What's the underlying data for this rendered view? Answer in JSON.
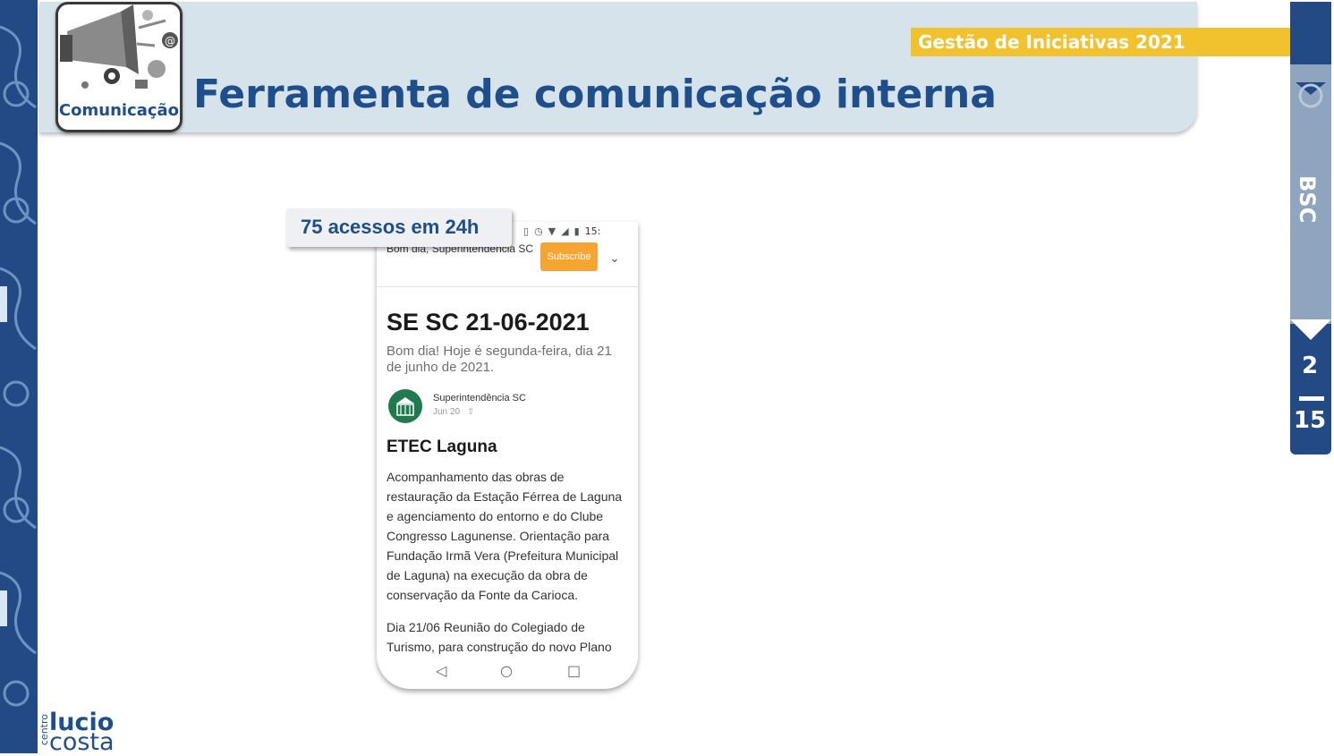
{
  "header": {
    "title": "Ferramenta de comunicação interna",
    "badge": "Gestão de Iniciativas 2021",
    "category_label": "Comunicação",
    "category_icon": "megaphone-icon"
  },
  "side_tab": {
    "label": "BSC",
    "page_current": "2",
    "page_total": "15"
  },
  "callout": {
    "text": "75 acessos em 24h"
  },
  "phone": {
    "status_time": "15:",
    "greeting": "Bom dia, Superintendência SC",
    "subscribe_label": "Subscribe",
    "post_title": "SE SC 21-06-2021",
    "post_subtitle": "Bom dia! Hoje é segunda-feira, dia 21 de junho de 2021.",
    "author": "Superintendência SC",
    "date": "Jun 20",
    "section_title": "ETEC Laguna",
    "body_1": "Acompanhamento das obras de restauração da Estação Férrea de Laguna e agenciamento do entorno e do Clube Congresso Lagunense. Orientação para Fundação Irmã Vera (Prefeitura Municipal de Laguna) na execução da obra de conservação da Fonte da Carioca.",
    "body_2": "Dia 21/06 Reunião do Colegiado de Turismo, para construção do novo Plano"
  },
  "footer": {
    "logo_small": "centro",
    "logo_line1": "lucio",
    "logo_line2": "costa"
  },
  "colors": {
    "brand_blue": "#1f4e8c",
    "dark_blue": "#234a84",
    "header_bg": "#d6e3ea",
    "badge_yellow": "#f2c12e",
    "subscribe_orange": "#f7a532"
  }
}
